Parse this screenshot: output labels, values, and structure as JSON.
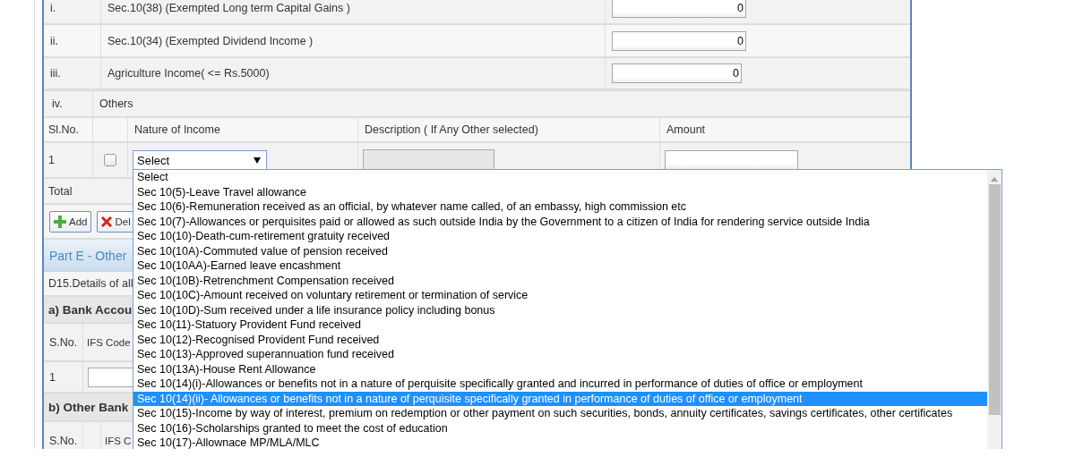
{
  "exempt_rows": [
    {
      "label": "i.",
      "description": "Sec.10(38) (Exempted Long term Capital Gains )",
      "amount": "0"
    },
    {
      "label": "ii.",
      "description": "Sec.10(34) (Exempted Dividend Income )",
      "amount": "0"
    },
    {
      "label": "iii.",
      "description": "Agriculture Income( <= Rs.5000)",
      "amount": "0"
    }
  ],
  "others": {
    "label": "iv.",
    "title": "Others",
    "columns": [
      "Sl.No.",
      "Nature of Income",
      "Description ( If Any Other selected)",
      "Amount"
    ],
    "rows": [
      {
        "number": "1",
        "checked": false,
        "nature": "Select",
        "expanded": true,
        "description_disabled": true
      }
    ],
    "total_label": "Total"
  },
  "buttons": [
    {
      "kind": "add",
      "label": "Add"
    },
    {
      "kind": "delete",
      "label": "Del"
    }
  ],
  "part_e": {
    "title": "Part E - Other"
  },
  "d15": "D15.Details of all",
  "bank_a": {
    "title": "a) Bank Accou",
    "columns": [
      "S.No.",
      "IFS Code"
    ],
    "rows": [
      {
        "number": "1"
      }
    ]
  },
  "bank_b": {
    "title": "b) Other Bank",
    "columns": [
      "S.No.",
      "IFS C"
    ]
  },
  "dropdown": {
    "options": [
      {
        "label": "Select",
        "selected": false
      },
      {
        "label": "Sec 10(5)-Leave Travel allowance",
        "selected": false
      },
      {
        "label": "Sec 10(6)-Remuneration received as an official, by whatever name called, of an embassy, high commission etc",
        "selected": false
      },
      {
        "label": "Sec 10(7)-Allowances or perquisites paid or allowed as such outside India by the Government to a citizen of India for rendering service outside India",
        "selected": false
      },
      {
        "label": "Sec 10(10)-Death-cum-retirement gratuity received",
        "selected": false
      },
      {
        "label": "Sec 10(10A)-Commuted value of pension received",
        "selected": false
      },
      {
        "label": "Sec 10(10AA)-Earned leave encashment",
        "selected": false
      },
      {
        "label": "Sec 10(10B)-Retrenchment Compensation received",
        "selected": false
      },
      {
        "label": "Sec 10(10C)-Amount received on voluntary retirement or termination of service",
        "selected": false
      },
      {
        "label": "Sec 10(10D)-Sum received under a life insurance policy including bonus",
        "selected": false
      },
      {
        "label": "Sec 10(11)-Statuory Provident Fund received",
        "selected": false
      },
      {
        "label": "Sec 10(12)-Recognised Provident Fund received",
        "selected": false
      },
      {
        "label": "Sec 10(13)-Approved superannuation fund received",
        "selected": false
      },
      {
        "label": "Sec 10(13A)-House Rent Allowance",
        "selected": false
      },
      {
        "label": "Sec 10(14)(i)-Allowances or benefits not in a nature of perquisite specifically granted and incurred in performance of duties of office or employment",
        "selected": false
      },
      {
        "label": "Sec 10(14)(ii)- Allowances or benefits not in a nature of perquisite specifically granted in performance of duties of office or employment",
        "selected": true
      },
      {
        "label": "Sec 10(15)-Income by way of interest, premium on redemption or other payment on such securities, bonds, annuity certificates, savings certificates, other certificates",
        "selected": false
      },
      {
        "label": "Sec 10(16)-Scholarships granted to meet the cost of education",
        "selected": false
      },
      {
        "label": "Sec 10(17)-Allownace MP/MLA/MLC",
        "selected": false
      }
    ]
  }
}
